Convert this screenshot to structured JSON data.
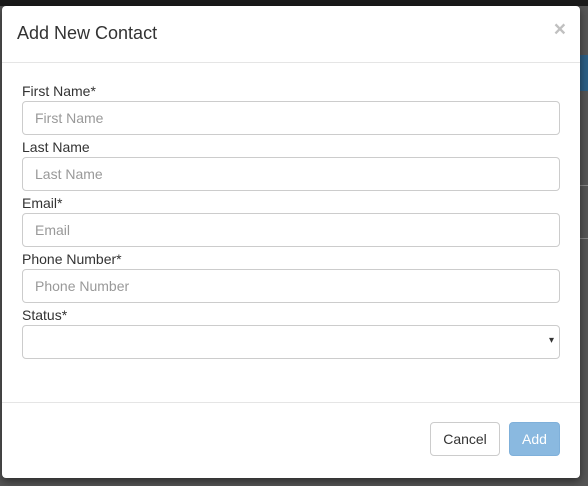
{
  "modal": {
    "title": "Add New Contact",
    "close_glyph": "×"
  },
  "form": {
    "first_name": {
      "label": "First Name*",
      "placeholder": "First Name",
      "value": ""
    },
    "last_name": {
      "label": "Last Name",
      "placeholder": "Last Name",
      "value": ""
    },
    "email": {
      "label": "Email*",
      "placeholder": "Email",
      "value": ""
    },
    "phone": {
      "label": "Phone Number*",
      "placeholder": "Phone Number",
      "value": ""
    },
    "status": {
      "label": "Status*",
      "selected": "",
      "caret": "▾"
    }
  },
  "footer": {
    "cancel_label": "Cancel",
    "add_label": "Add"
  },
  "colors": {
    "primary_disabled": "#8ab9e0",
    "border": "#cccccc"
  }
}
